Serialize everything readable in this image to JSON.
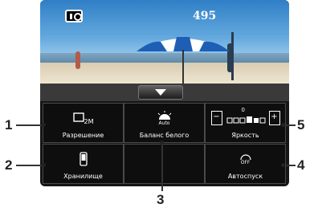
{
  "viewfinder": {
    "shot_counter": "495",
    "mode_icon": "camera-icon"
  },
  "expand_button": {
    "icon": "triangle-down-icon"
  },
  "settings": {
    "resolution": {
      "label": "Разрешение",
      "icon_text": "2M"
    },
    "white_balance": {
      "label": "Баланс белого",
      "icon_text": "Auto"
    },
    "brightness": {
      "label": "Яркость",
      "level_text": "0",
      "minus": "−",
      "plus": "+"
    },
    "storage": {
      "label": "Хранилище"
    },
    "self_timer": {
      "label": "Автоспуск",
      "icon_text": "OFF"
    }
  },
  "callouts": [
    "1",
    "2",
    "3",
    "4",
    "5"
  ]
}
